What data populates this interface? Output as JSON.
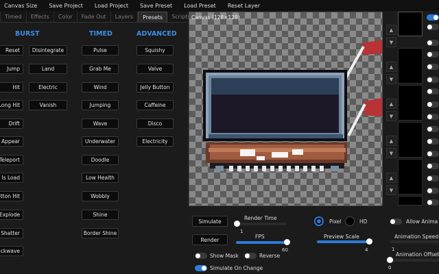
{
  "menu": [
    "Canvas Size",
    "Save Project",
    "Load Project",
    "Save Preset",
    "Load Preset",
    "Reset Layer"
  ],
  "tabs": [
    {
      "label": "Timed"
    },
    {
      "label": "Effects"
    },
    {
      "label": "Color"
    },
    {
      "label": "Fade Out"
    },
    {
      "label": "Layers"
    },
    {
      "label": "Presets"
    },
    {
      "label": "Scripts"
    }
  ],
  "active_tab": "Presets",
  "presets": {
    "burst": {
      "title": "BURST",
      "left": [
        "Reset",
        "Jump",
        "Hit",
        "Long Hit",
        "Drift",
        "Appear",
        "Teleport",
        "Is Load",
        "Button Hit",
        "Explode",
        "Shatter",
        "Backwave"
      ],
      "right": [
        "Disintegrate",
        "Land",
        "Electric",
        "Vanish"
      ]
    },
    "timed": {
      "title": "TIMED",
      "items": [
        "Pulse",
        "Grab Me",
        "Wind",
        "Jumping",
        "Wave",
        "Underwater",
        "Doodle",
        "Low Health",
        "Wobbly",
        "Shine",
        "Border Shine"
      ]
    },
    "advanced": {
      "title": "ADVANCED",
      "items": [
        "Squishy",
        "Valve",
        "Jelly Button",
        "Caffeine",
        "Disco",
        "Electricity"
      ]
    }
  },
  "canvas": {
    "title": "Canvas (128×128)"
  },
  "controls": {
    "simulate_label": "Simulate",
    "render_label": "Render",
    "render_time": {
      "label": "Render Time",
      "value": "1",
      "fraction": 0.02
    },
    "fps": {
      "label": "FPS",
      "value": "60",
      "fraction": 1.0
    },
    "show_mask": {
      "label": "Show Mask",
      "on": false
    },
    "reverse": {
      "label": "Reverse",
      "on": false
    },
    "simulate_on_change": {
      "label": "Simulate On Change",
      "on": true
    },
    "pixel_label": "Pixel",
    "hd_label": "HD",
    "mode_selected": "Pixel",
    "preview_scale": {
      "label": "Preview Scale",
      "value": "4",
      "fraction": 1.0
    },
    "allow_animation": {
      "label": "Allow Anima",
      "on": false
    },
    "animation_speed": {
      "label": "Animation Speed",
      "value": "1"
    },
    "animation_offset": {
      "label": "Animation Offset",
      "value": "0"
    }
  },
  "layer_arrows": [
    "▲",
    "▼"
  ],
  "colors": {
    "accent": "#2e7bd6",
    "heading": "#3a8ee6",
    "crab": "#b83236"
  }
}
